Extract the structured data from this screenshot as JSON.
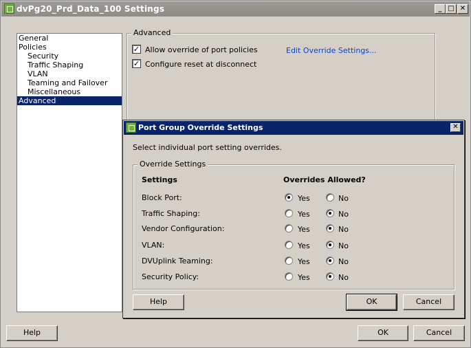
{
  "window": {
    "title": "dvPg20_Prd_Data_100 Settings",
    "controls": [
      "_",
      "□",
      "✕"
    ]
  },
  "nav": [
    {
      "label": "General",
      "child": false,
      "selected": false
    },
    {
      "label": "Policies",
      "child": false,
      "selected": false
    },
    {
      "label": "Security",
      "child": true,
      "selected": false
    },
    {
      "label": "Traffic Shaping",
      "child": true,
      "selected": false
    },
    {
      "label": "VLAN",
      "child": true,
      "selected": false
    },
    {
      "label": "Teaming and Failover",
      "child": true,
      "selected": false
    },
    {
      "label": "Miscellaneous",
      "child": true,
      "selected": false
    },
    {
      "label": "Advanced",
      "child": false,
      "selected": true
    }
  ],
  "advanced": {
    "group_label": "Advanced",
    "allow_override": {
      "label": "Allow override of port policies",
      "checked": true
    },
    "configure_reset": {
      "label": "Configure reset at disconnect",
      "checked": true
    },
    "edit_link": "Edit Override Settings..."
  },
  "dialog": {
    "title": "Port Group Override Settings",
    "close": "✕",
    "instruction": "Select individual port setting overrides.",
    "group_label": "Override Settings",
    "col_settings": "Settings",
    "col_allowed": "Overrides Allowed?",
    "yes_label": "Yes",
    "no_label": "No",
    "rows": [
      {
        "label": "Block Port:",
        "value": "Yes"
      },
      {
        "label": "Traffic Shaping:",
        "value": "No"
      },
      {
        "label": "Vendor Configuration:",
        "value": "No"
      },
      {
        "label": "VLAN:",
        "value": "No"
      },
      {
        "label": "DVUplink Teaming:",
        "value": "No"
      },
      {
        "label": "Security Policy:",
        "value": "No"
      }
    ],
    "help_button": "Help",
    "ok_button": "OK",
    "cancel_button": "Cancel"
  },
  "footer": {
    "help_button": "Help",
    "ok_button": "OK",
    "cancel_button": "Cancel"
  },
  "check_mark": "✓"
}
